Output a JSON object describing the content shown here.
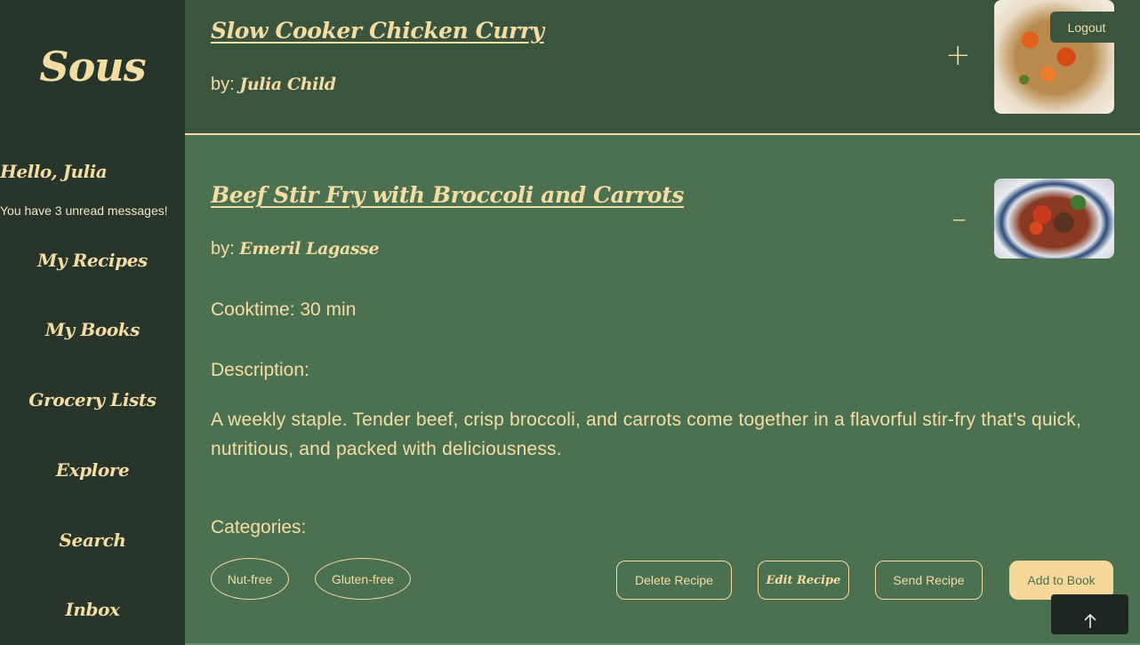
{
  "sidebar": {
    "brand": "Sous",
    "greeting": "Hello, Julia",
    "unread_message": "You have 3 unread messages!",
    "nav": [
      {
        "label": "My Recipes"
      },
      {
        "label": "My Books"
      },
      {
        "label": "Grocery Lists"
      },
      {
        "label": "Explore"
      },
      {
        "label": "Search"
      },
      {
        "label": "Inbox"
      }
    ]
  },
  "header": {
    "logout_label": "Logout"
  },
  "recipes": [
    {
      "title": "Slow Cooker Chicken Curry",
      "by_prefix": "by:",
      "author": "Julia Child",
      "toggle": "+",
      "image_icon": "chicken-curry-photo"
    },
    {
      "title": "Beef Stir Fry with Broccoli and Carrots",
      "by_prefix": "by:",
      "author": "Emeril Lagasse",
      "toggle": "–",
      "image_icon": "beef-stir-fry-photo",
      "cooktime": "Cooktime: 30 min",
      "description_label": "Description:",
      "description": "A weekly staple. Tender beef, crisp broccoli, and carrots come together in a flavorful stir-fry that's quick, nutritious, and packed with deliciousness.",
      "categories_label": "Categories:",
      "categories": [
        "Nut-free",
        "Gluten-free"
      ],
      "actions": {
        "delete": "Delete Recipe",
        "edit": "Edit Recipe",
        "send": "Send Recipe",
        "add": "Add to Book"
      }
    }
  ],
  "scroll_top_icon": "arrow-up-icon",
  "colors": {
    "sidebar_bg": "#28352b",
    "main_bg": "#4c7150",
    "collapsed_card_bg": "#3a543d",
    "accent_cream": "#f3dda4",
    "primary_button": "#f6d89a"
  }
}
